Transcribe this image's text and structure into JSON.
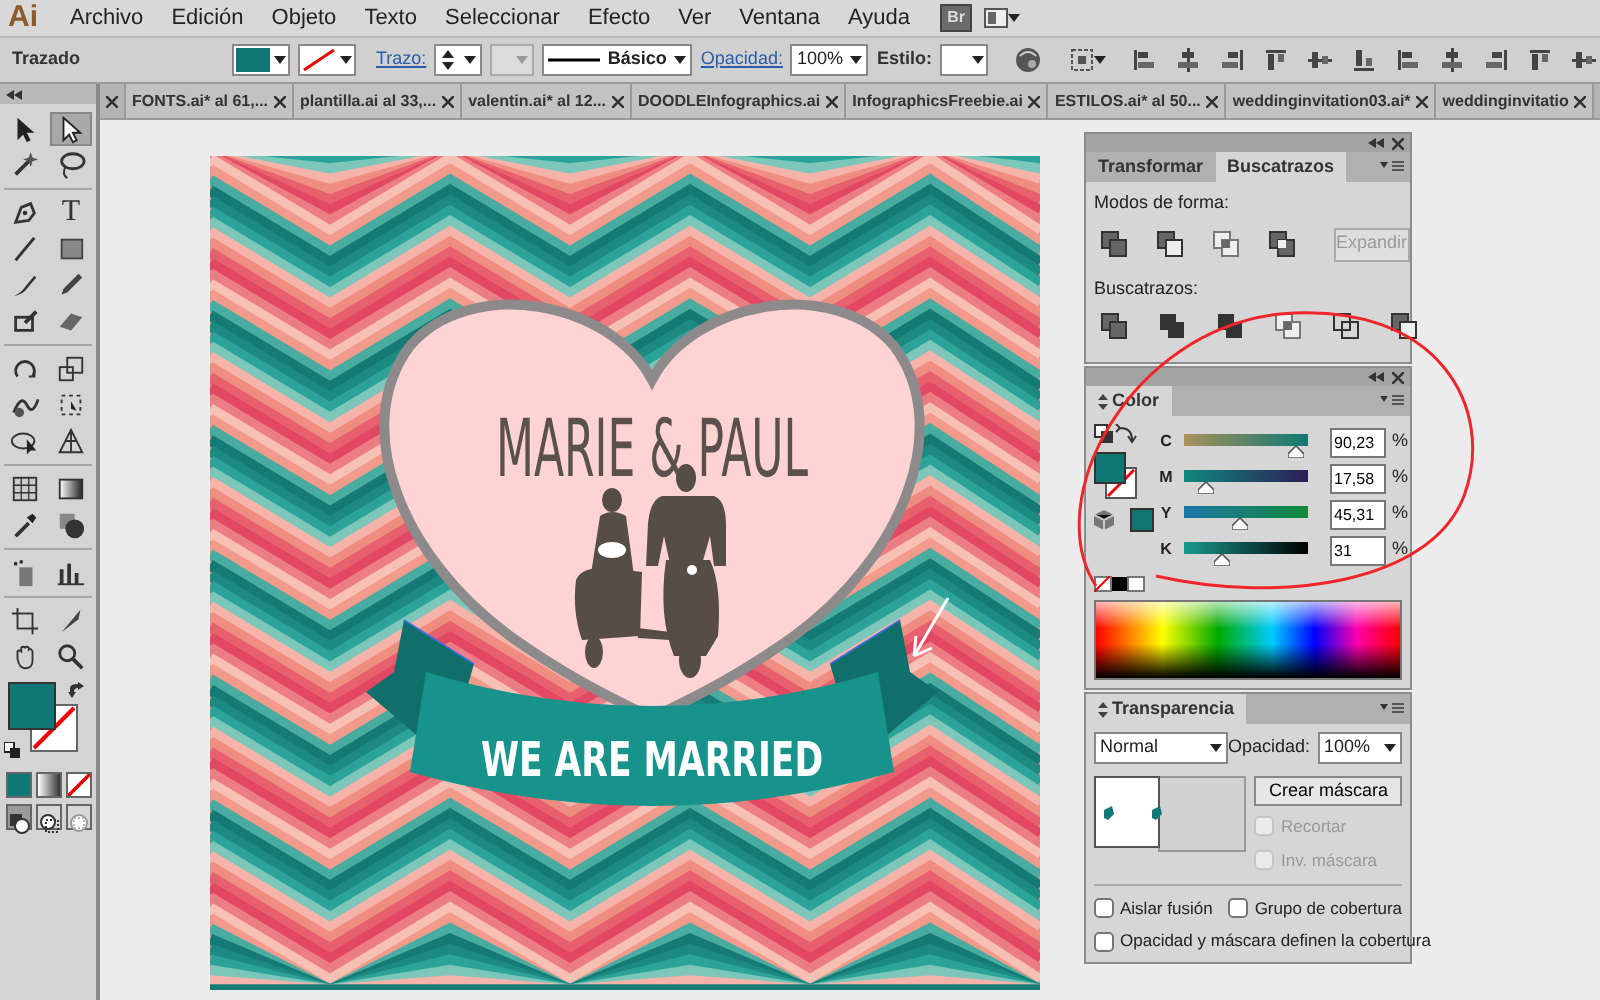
{
  "app": {
    "logo": "Ai",
    "bridge_button": "Br"
  },
  "menu": [
    "Archivo",
    "Edición",
    "Objeto",
    "Texto",
    "Seleccionar",
    "Efecto",
    "Ver",
    "Ventana",
    "Ayuda"
  ],
  "control_bar": {
    "selection_type": "Trazado",
    "stroke_link": "Trazo:",
    "brush": "Básico",
    "opacity_link": "Opacidad:",
    "opacity": "100%",
    "style_label": "Estilo:"
  },
  "doc_tabs": [
    {
      "label": "FONTS.ai* al 61,..."
    },
    {
      "label": "plantilla.ai al 33,..."
    },
    {
      "label": "valentin.ai* al 12..."
    },
    {
      "label": "DOODLEInfographics.ai"
    },
    {
      "label": "InfographicsFreebie.ai"
    },
    {
      "label": "ESTILOS.ai* al 50..."
    },
    {
      "label": "weddinginvitation03.ai*"
    },
    {
      "label": "weddinginvitatio"
    }
  ],
  "tools": [
    {
      "kind": "selection",
      "selected": false
    },
    {
      "kind": "direct-selection",
      "selected": true
    },
    {
      "kind": "magic-wand",
      "selected": false
    },
    {
      "kind": "lasso",
      "selected": false
    },
    {
      "kind": "pen",
      "selected": false
    },
    {
      "kind": "type",
      "glyph": "T",
      "selected": false
    },
    {
      "kind": "line",
      "selected": false
    },
    {
      "kind": "rectangle",
      "selected": false
    },
    {
      "kind": "brush",
      "selected": false
    },
    {
      "kind": "pencil",
      "selected": false
    },
    {
      "kind": "blob",
      "selected": false
    },
    {
      "kind": "eraser",
      "selected": false
    },
    {
      "kind": "rotate",
      "selected": false
    },
    {
      "kind": "scale",
      "selected": false
    },
    {
      "kind": "warp",
      "selected": false
    },
    {
      "kind": "free-transform",
      "selected": false
    },
    {
      "kind": "shape-builder",
      "selected": false
    },
    {
      "kind": "perspective",
      "selected": false
    },
    {
      "kind": "mesh",
      "selected": false
    },
    {
      "kind": "gradient",
      "selected": false
    },
    {
      "kind": "eyedropper",
      "selected": false
    },
    {
      "kind": "blend",
      "selected": false
    },
    {
      "kind": "symbol-sprayer",
      "selected": false
    },
    {
      "kind": "graph",
      "selected": false
    },
    {
      "kind": "artboard",
      "selected": false
    },
    {
      "kind": "slice",
      "selected": false
    },
    {
      "kind": "hand",
      "selected": false
    },
    {
      "kind": "zoom",
      "selected": false
    }
  ],
  "draw_modes": [
    {
      "kind": "normal",
      "selected": true
    },
    {
      "kind": "behind",
      "selected": false
    },
    {
      "kind": "inside",
      "selected": false
    }
  ],
  "artwork": {
    "names": "MARIE & PAUL",
    "banner": "WE ARE MARRIED"
  },
  "pathfinder_panel": {
    "tabs": [
      {
        "label": "Transformar",
        "selected": false
      },
      {
        "label": "Buscatrazos",
        "selected": true
      }
    ],
    "shape_modes_label": "Modos de forma:",
    "expand_button": {
      "label": "Expandir",
      "disabled": true
    },
    "pathfinders_label": "Buscatrazos:"
  },
  "color_panel": {
    "title": "Color",
    "channels": [
      {
        "name": "C",
        "value": "90,23",
        "unit": "%",
        "level": 0.9023
      },
      {
        "name": "M",
        "value": "17,58",
        "unit": "%",
        "level": 0.1758
      },
      {
        "name": "Y",
        "value": "45,31",
        "unit": "%",
        "level": 0.4531
      },
      {
        "name": "K",
        "value": "31",
        "unit": "%",
        "level": 0.31
      }
    ]
  },
  "transparency_panel": {
    "title": "Transparencia",
    "blend_mode": "Normal",
    "opacity_label": "Opacidad:",
    "opacity": "100%",
    "mask_button": "Crear máscara",
    "options": [
      {
        "label": "Recortar",
        "checked": false,
        "disabled": true
      },
      {
        "label": "Inv. máscara",
        "checked": false,
        "disabled": true
      },
      {
        "label": "Aislar fusión",
        "checked": false,
        "disabled": false
      },
      {
        "label": "Grupo de cobertura",
        "checked": false,
        "disabled": false
      },
      {
        "label": "Opacidad y máscara definen la cobertura",
        "checked": false,
        "disabled": false
      }
    ]
  }
}
